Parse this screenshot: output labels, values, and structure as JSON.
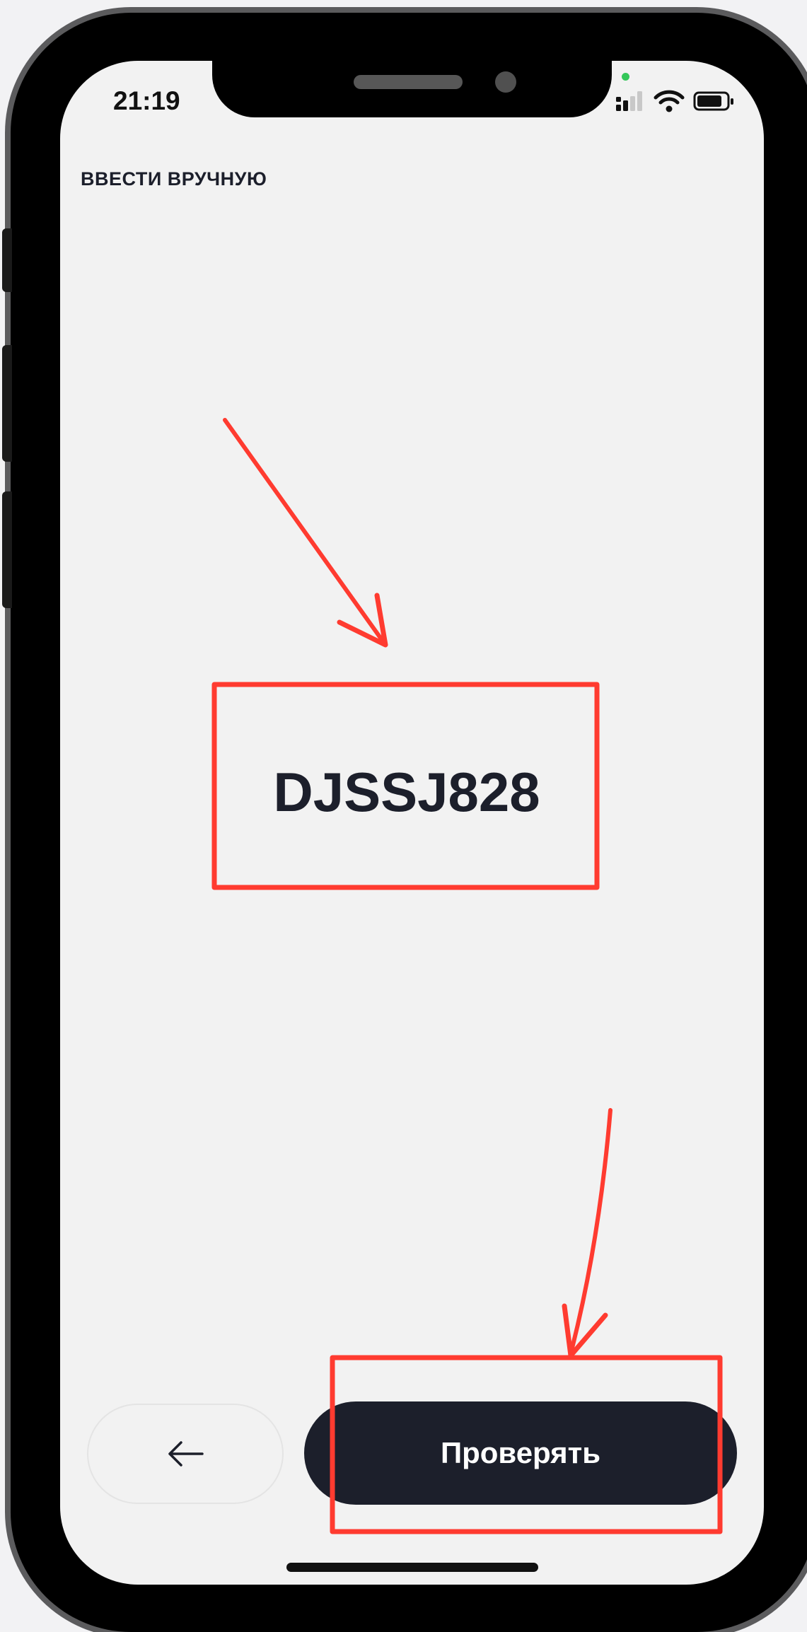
{
  "status_bar": {
    "time": "21:19"
  },
  "screen": {
    "manual_entry_label": "ВВЕСТИ ВРУЧНУЮ",
    "code": "DJSSJ828"
  },
  "buttons": {
    "back_icon": "arrow-left-icon",
    "verify_label": "Проверять"
  },
  "colors": {
    "primary_dark": "#1c1f2b",
    "annotation_red": "#ff3b30",
    "screen_background": "#f2f2f2"
  }
}
